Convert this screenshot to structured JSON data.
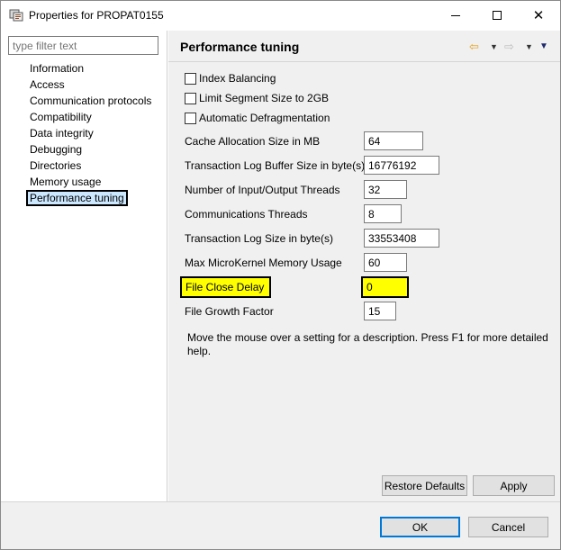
{
  "window": {
    "title": "Properties for PROPAT0155",
    "minimize": "—",
    "maximize": "□",
    "close": "✕"
  },
  "filter": {
    "placeholder": "type filter text"
  },
  "nav_tree": [
    {
      "label": "Information"
    },
    {
      "label": "Access"
    },
    {
      "label": "Communication protocols"
    },
    {
      "label": "Compatibility"
    },
    {
      "label": "Data integrity"
    },
    {
      "label": "Debugging"
    },
    {
      "label": "Directories"
    },
    {
      "label": "Memory usage"
    },
    {
      "label": "Performance tuning",
      "selected": true
    }
  ],
  "page": {
    "title": "Performance tuning",
    "icons": {
      "back": "back-arrow-icon",
      "forward": "forward-arrow-icon",
      "menu": "view-menu-icon"
    }
  },
  "checkboxes": [
    {
      "label": "Index Balancing",
      "checked": false
    },
    {
      "label": "Limit Segment Size to 2GB",
      "checked": false
    },
    {
      "label": "Automatic Defragmentation",
      "checked": false
    }
  ],
  "fields": {
    "cache_allocation": {
      "label": "Cache Allocation Size in MB",
      "value": "64"
    },
    "tx_log_buffer": {
      "label": "Transaction Log Buffer Size in byte(s)",
      "value": "16776192"
    },
    "io_threads": {
      "label": "Number of Input/Output Threads",
      "value": "32"
    },
    "comm_threads": {
      "label": "Communications Threads",
      "value": "8"
    },
    "tx_log_size": {
      "label": "Transaction Log Size in byte(s)",
      "value": "33553408"
    },
    "max_microkernel": {
      "label": "Max MicroKernel Memory Usage",
      "value": "60"
    },
    "file_close_delay": {
      "label": "File Close Delay",
      "value": "0"
    },
    "file_growth": {
      "label": "File Growth Factor",
      "value": "15"
    }
  },
  "help_text": "Move the mouse over a setting for a description. Press F1 for more detailed help.",
  "buttons": {
    "restore_defaults": "Restore Defaults",
    "apply": "Apply",
    "ok": "OK",
    "cancel": "Cancel"
  },
  "colors": {
    "highlight": "#ffff00",
    "selection": "#cce8ff",
    "default_button_border": "#0078d7"
  }
}
